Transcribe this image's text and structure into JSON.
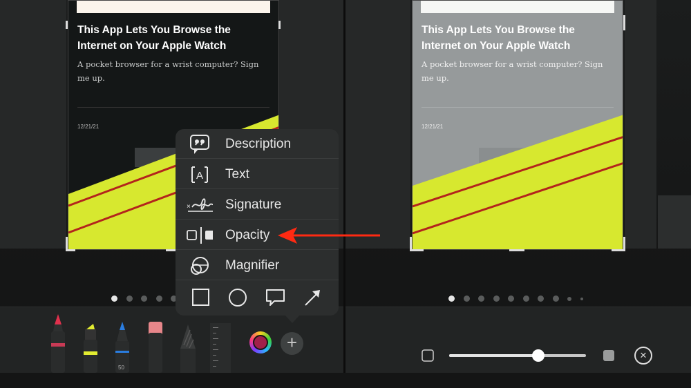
{
  "article": {
    "headline": "This App Lets You Browse the Internet on Your Apple Watch",
    "subhead": "A pocket browser for a wrist computer? Sign me up.",
    "date": "12/21/21"
  },
  "menu": {
    "items": [
      {
        "label": "Description",
        "icon": "quote-bubble-icon"
      },
      {
        "label": "Text",
        "icon": "text-box-icon"
      },
      {
        "label": "Signature",
        "icon": "signature-icon"
      },
      {
        "label": "Opacity",
        "icon": "opacity-icon"
      },
      {
        "label": "Magnifier",
        "icon": "magnifier-icon"
      }
    ],
    "shapes": [
      "square-shape-icon",
      "circle-shape-icon",
      "speech-bubble-shape-icon",
      "arrow-shape-icon"
    ]
  },
  "toolbar": {
    "pen_width_label": "50",
    "selected_color": "#a12049",
    "add_button_label": "+"
  },
  "pager": {
    "left_dots": 5,
    "left_active": 0,
    "right_dots": 10,
    "right_active": 0
  },
  "opacity": {
    "level": 0.65,
    "close_label": "×"
  },
  "colors": {
    "highlight_yellow": "#d7e82f",
    "stripe_red": "#b3241c",
    "annotation_arrow": "#ff2a12",
    "menu_bg": "#2c2e2e"
  }
}
